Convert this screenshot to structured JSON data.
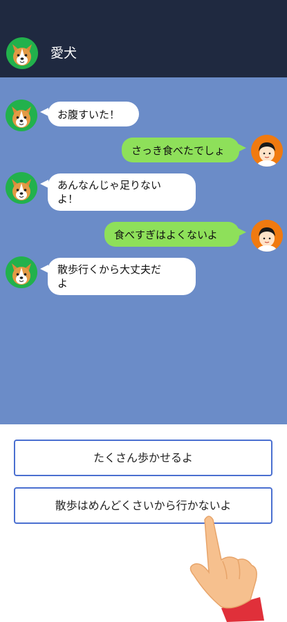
{
  "header": {
    "title": "愛犬"
  },
  "messages": [
    {
      "side": "in",
      "text": "お腹すいた！"
    },
    {
      "side": "out",
      "text": "さっき食べたでしょ"
    },
    {
      "side": "in",
      "text": "あんなんじゃ足りない\nよ！"
    },
    {
      "side": "out",
      "text": "食べすぎはよくないよ"
    },
    {
      "side": "in",
      "text": "散歩行くから大丈夫だ\nよ"
    }
  ],
  "choices": [
    {
      "label": "たくさん歩かせるよ"
    },
    {
      "label": "散歩はめんどくさいから行かないよ"
    }
  ],
  "colors": {
    "header_bg": "#1f2940",
    "chat_bg": "#6b8cc8",
    "incoming_bubble": "#ffffff",
    "outgoing_bubble": "#8ee05a",
    "choice_border": "#4a6fd0"
  }
}
